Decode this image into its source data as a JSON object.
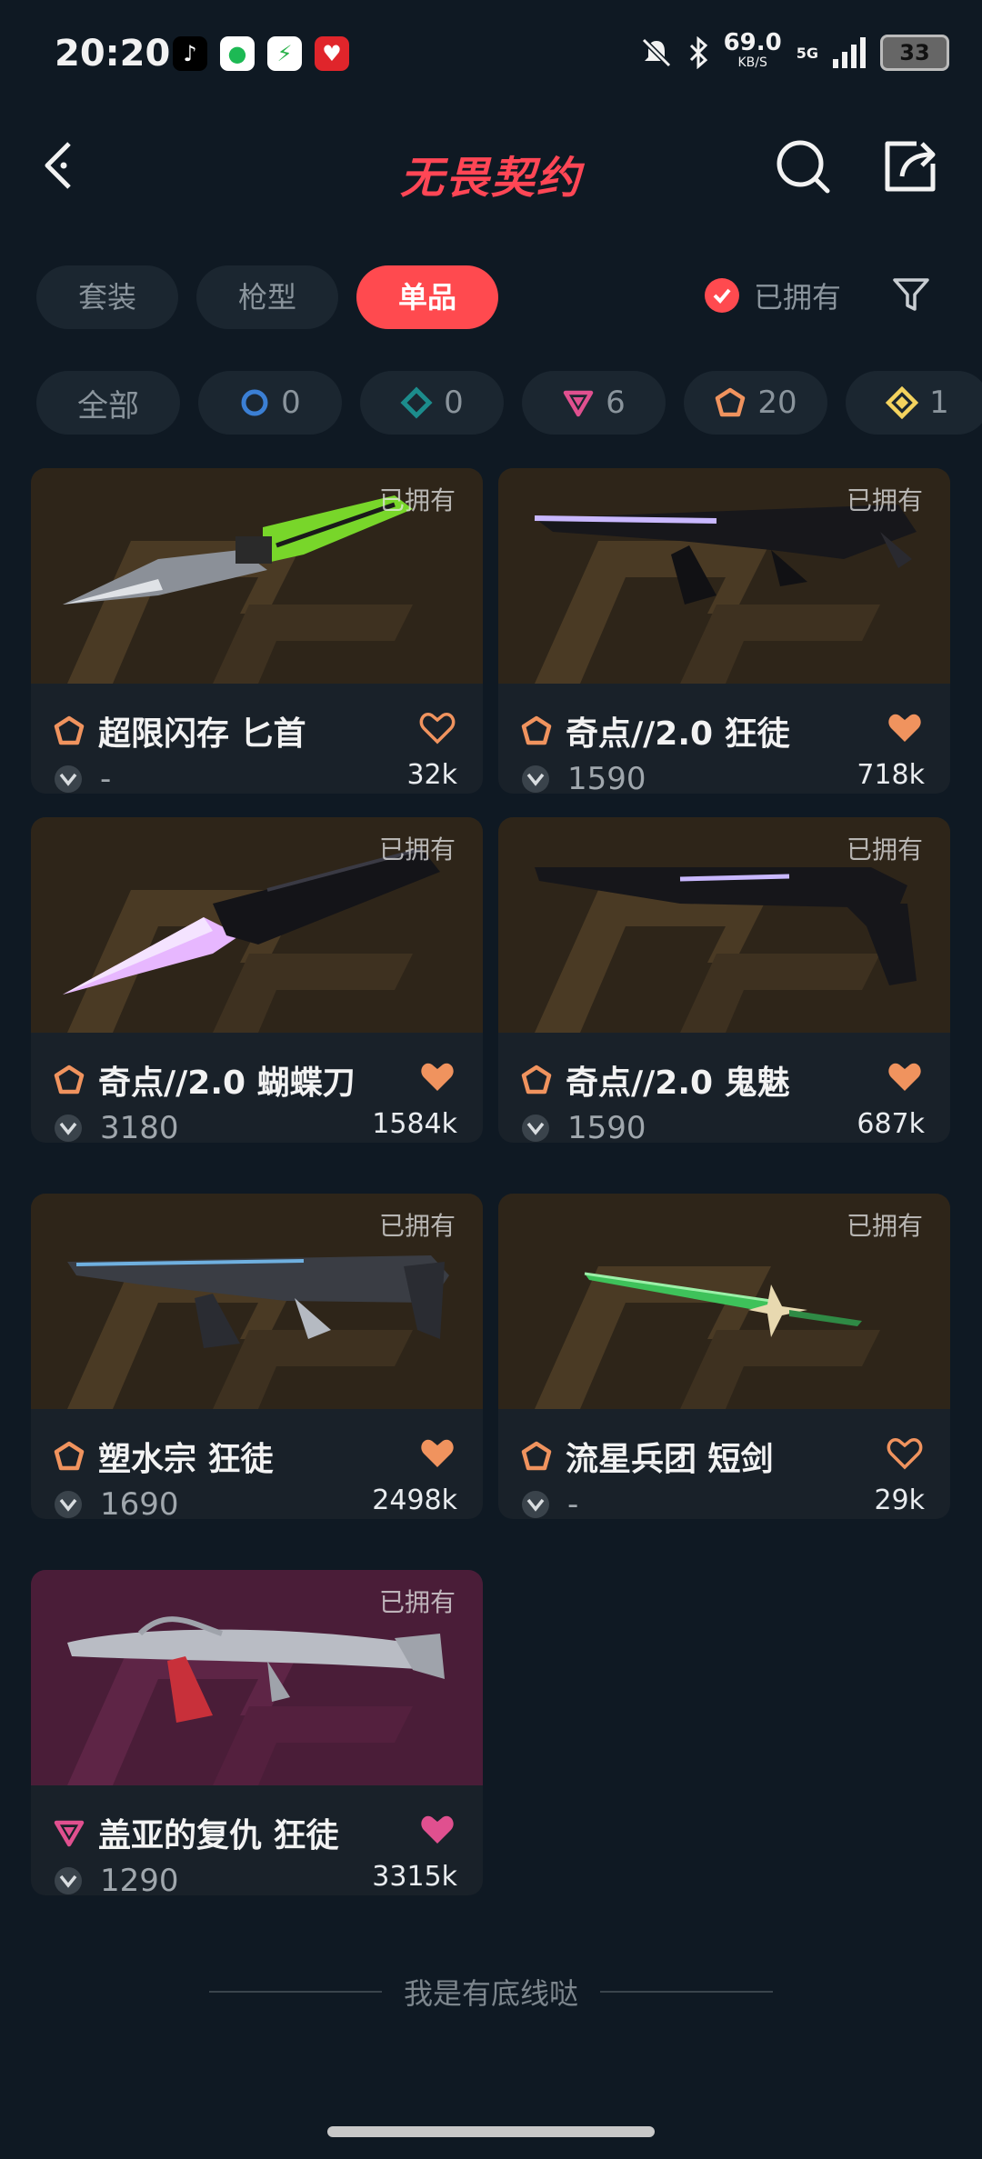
{
  "status": {
    "time": "20:20",
    "net_speed": "69.0",
    "net_unit": "KB/S",
    "network": "5G",
    "battery": "33"
  },
  "header": {
    "title": "无畏契约"
  },
  "tabs": [
    {
      "label": "套装",
      "active": false
    },
    {
      "label": "枪型",
      "active": false
    },
    {
      "label": "单品",
      "active": true
    }
  ],
  "owned_filter": {
    "label": "已拥有",
    "checked": true
  },
  "rarity_chips": [
    {
      "label": "全部"
    },
    {
      "icon": "select-tier-icon",
      "count": "0",
      "color": "#3b7fd4"
    },
    {
      "icon": "deluxe-tier-icon",
      "count": "0",
      "color": "#1c8c8c"
    },
    {
      "icon": "premium-tier-icon",
      "count": "6",
      "color": "#e0508f"
    },
    {
      "icon": "exclusive-tier-icon",
      "count": "20",
      "color": "#f0935e"
    },
    {
      "icon": "ultra-tier-icon",
      "count": "1",
      "color": "#f4d35e"
    }
  ],
  "items": [
    {
      "name": "超限闪存 匕首",
      "price": "-",
      "likes": "32k",
      "owned_label": "已拥有",
      "tier": "exclusive",
      "favorited": false
    },
    {
      "name": "奇点//2.0 狂徒",
      "price": "1590",
      "likes": "718k",
      "owned_label": "已拥有",
      "tier": "exclusive",
      "favorited": true
    },
    {
      "name": "奇点//2.0 蝴蝶刀",
      "price": "3180",
      "likes": "1584k",
      "owned_label": "已拥有",
      "tier": "exclusive",
      "favorited": true
    },
    {
      "name": "奇点//2.0 鬼魅",
      "price": "1590",
      "likes": "687k",
      "owned_label": "已拥有",
      "tier": "exclusive",
      "favorited": true
    },
    {
      "name": "塑水宗 狂徒",
      "price": "1690",
      "likes": "2498k",
      "owned_label": "已拥有",
      "tier": "exclusive",
      "favorited": true
    },
    {
      "name": "流星兵团 短剑",
      "price": "-",
      "likes": "29k",
      "owned_label": "已拥有",
      "tier": "exclusive",
      "favorited": false
    },
    {
      "name": "盖亚的复仇 狂徒",
      "price": "1290",
      "likes": "3315k",
      "owned_label": "已拥有",
      "tier": "premium",
      "favorited": true
    }
  ],
  "end_note": "我是有底线哒",
  "colors": {
    "accent": "#ff4a4f",
    "exclusive": "#f0935e",
    "premium": "#e0508f",
    "background": "#0f1923"
  }
}
